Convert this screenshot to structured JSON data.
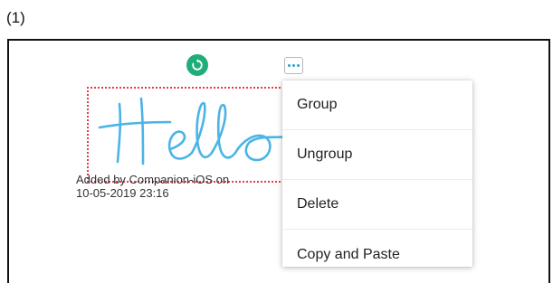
{
  "step_label": "(1)",
  "toolbar": {
    "rotate_icon": "rotate-icon",
    "more_icon": "more-horizontal-icon",
    "rotate_color": "#1fae7a",
    "more_dot_color": "#2a9fd6"
  },
  "ink": {
    "text": "Hello",
    "stroke_color": "#4ab4e6"
  },
  "selection": {
    "border_color": "#e63946"
  },
  "caption": {
    "line1": "Added by Companion-iOS on",
    "line2": "10-05-2019 23:16"
  },
  "context_menu": {
    "items": [
      {
        "label": "Group"
      },
      {
        "label": "Ungroup"
      },
      {
        "label": "Delete"
      },
      {
        "label": "Copy and Paste"
      }
    ]
  }
}
